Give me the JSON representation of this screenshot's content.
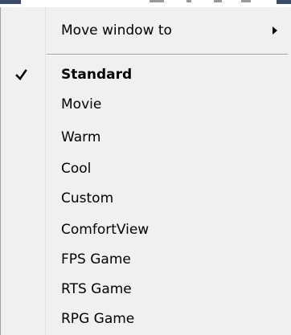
{
  "menu": {
    "move_window": {
      "label": "Move window to",
      "icon": "submenu-arrow-icon"
    },
    "items": [
      {
        "label": "Standard",
        "checked": true
      },
      {
        "label": "Movie",
        "checked": false
      },
      {
        "label": "Warm",
        "checked": false
      },
      {
        "label": "Cool",
        "checked": false
      },
      {
        "label": "Custom",
        "checked": false
      },
      {
        "label": "ComfortView",
        "checked": false
      },
      {
        "label": "FPS Game",
        "checked": false
      },
      {
        "label": "RTS Game",
        "checked": false
      },
      {
        "label": "RPG Game",
        "checked": false
      }
    ]
  },
  "colors": {
    "menu_background": "#f0f0f0",
    "text": "#000000",
    "separator": "#a0a0a0"
  }
}
